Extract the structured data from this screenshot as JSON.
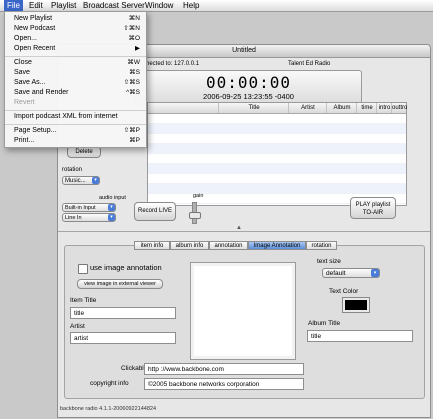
{
  "menubar": {
    "apple": "",
    "items": [
      "File",
      "Edit",
      "Playlist",
      "Broadcast Server",
      "Window",
      "Help"
    ]
  },
  "file_menu": {
    "items": [
      {
        "label": "New Playlist",
        "shortcut": "⌘N"
      },
      {
        "label": "New Podcast",
        "shortcut": "⇧⌘N"
      },
      {
        "label": "Open...",
        "shortcut": "⌘O"
      },
      {
        "label": "Open Recent",
        "shortcut": "▶"
      },
      {
        "label": "Close",
        "shortcut": "⌘W"
      },
      {
        "label": "Save",
        "shortcut": "⌘S"
      },
      {
        "label": "Save As...",
        "shortcut": "⇧⌘S"
      },
      {
        "label": "Save and Render",
        "shortcut": "^⌘S"
      },
      {
        "label": "Revert",
        "shortcut": "",
        "disabled": true
      },
      {
        "label": "Import podcast XML from internet",
        "shortcut": ""
      },
      {
        "label": "Page Setup...",
        "shortcut": "⇧⌘P"
      },
      {
        "label": "Print...",
        "shortcut": "⌘P"
      }
    ]
  },
  "window": {
    "title": "Untitled",
    "connected": "nected to: 127.0.0.1",
    "station": "Talent Ed Radio",
    "clock": "00:00:00",
    "clock_date": "2006-09-25 13:23:55 -0400"
  },
  "playlist_table": {
    "columns": [
      "Title",
      "Artist",
      "Album",
      "time",
      "intro",
      "outtro"
    ],
    "rows": []
  },
  "controls": {
    "delete": "Delete",
    "rotation_label": "rotation",
    "rotation_value": "Music...",
    "audio_input_label": "audio input",
    "audio_source": "Built-in Input",
    "audio_line": "Line In",
    "record": "Record LIVE",
    "gain_label": "gain",
    "gain_level": 0.5,
    "play_line1": "PLAY playlist",
    "play_line2": "TO-AIR"
  },
  "tabs": [
    {
      "label": "item info",
      "active": false
    },
    {
      "label": "album info",
      "active": false
    },
    {
      "label": "annotation",
      "active": false
    },
    {
      "label": "Image Annotation",
      "active": true
    },
    {
      "label": "rotation",
      "active": false
    }
  ],
  "image_annotation": {
    "use_image_label": "use image annotation",
    "view_image_button": "view image in external viewer",
    "item_title_label": "Item Title",
    "item_title_value": "title",
    "artist_label": "Artist",
    "artist_value": "artist",
    "text_size_label": "text size",
    "text_size_value": "default",
    "text_color_label": "Text Color",
    "text_color": "#000000",
    "album_title_label": "Album Title",
    "album_title_value": "title",
    "clickable_url_label": "Clickable url:",
    "clickable_url_value": "http ://www.backbone.com",
    "copyright_label": "copyright info",
    "copyright_value": "©2005 backbone networks corporation"
  },
  "status": {
    "version": "backbone radio 4.1.1-20060922144824"
  },
  "colors": {
    "menu_highlight": "#3b67c9",
    "active_tab": "#5d8fd9"
  }
}
